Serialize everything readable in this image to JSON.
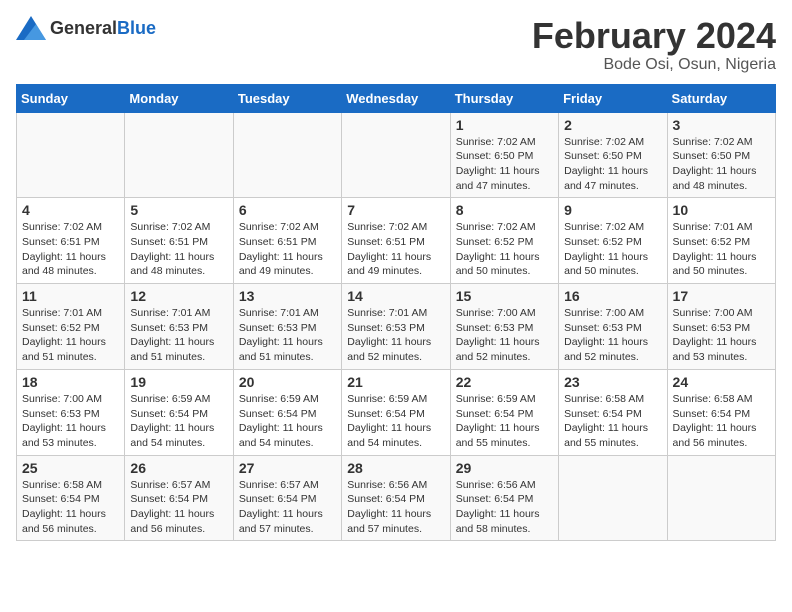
{
  "logo": {
    "text_general": "General",
    "text_blue": "Blue"
  },
  "title": "February 2024",
  "subtitle": "Bode Osi, Osun, Nigeria",
  "columns": [
    "Sunday",
    "Monday",
    "Tuesday",
    "Wednesday",
    "Thursday",
    "Friday",
    "Saturday"
  ],
  "weeks": [
    [
      {
        "day": "",
        "info": ""
      },
      {
        "day": "",
        "info": ""
      },
      {
        "day": "",
        "info": ""
      },
      {
        "day": "",
        "info": ""
      },
      {
        "day": "1",
        "info": "Sunrise: 7:02 AM\nSunset: 6:50 PM\nDaylight: 11 hours and 47 minutes."
      },
      {
        "day": "2",
        "info": "Sunrise: 7:02 AM\nSunset: 6:50 PM\nDaylight: 11 hours and 47 minutes."
      },
      {
        "day": "3",
        "info": "Sunrise: 7:02 AM\nSunset: 6:50 PM\nDaylight: 11 hours and 48 minutes."
      }
    ],
    [
      {
        "day": "4",
        "info": "Sunrise: 7:02 AM\nSunset: 6:51 PM\nDaylight: 11 hours and 48 minutes."
      },
      {
        "day": "5",
        "info": "Sunrise: 7:02 AM\nSunset: 6:51 PM\nDaylight: 11 hours and 48 minutes."
      },
      {
        "day": "6",
        "info": "Sunrise: 7:02 AM\nSunset: 6:51 PM\nDaylight: 11 hours and 49 minutes."
      },
      {
        "day": "7",
        "info": "Sunrise: 7:02 AM\nSunset: 6:51 PM\nDaylight: 11 hours and 49 minutes."
      },
      {
        "day": "8",
        "info": "Sunrise: 7:02 AM\nSunset: 6:52 PM\nDaylight: 11 hours and 50 minutes."
      },
      {
        "day": "9",
        "info": "Sunrise: 7:02 AM\nSunset: 6:52 PM\nDaylight: 11 hours and 50 minutes."
      },
      {
        "day": "10",
        "info": "Sunrise: 7:01 AM\nSunset: 6:52 PM\nDaylight: 11 hours and 50 minutes."
      }
    ],
    [
      {
        "day": "11",
        "info": "Sunrise: 7:01 AM\nSunset: 6:52 PM\nDaylight: 11 hours and 51 minutes."
      },
      {
        "day": "12",
        "info": "Sunrise: 7:01 AM\nSunset: 6:53 PM\nDaylight: 11 hours and 51 minutes."
      },
      {
        "day": "13",
        "info": "Sunrise: 7:01 AM\nSunset: 6:53 PM\nDaylight: 11 hours and 51 minutes."
      },
      {
        "day": "14",
        "info": "Sunrise: 7:01 AM\nSunset: 6:53 PM\nDaylight: 11 hours and 52 minutes."
      },
      {
        "day": "15",
        "info": "Sunrise: 7:00 AM\nSunset: 6:53 PM\nDaylight: 11 hours and 52 minutes."
      },
      {
        "day": "16",
        "info": "Sunrise: 7:00 AM\nSunset: 6:53 PM\nDaylight: 11 hours and 52 minutes."
      },
      {
        "day": "17",
        "info": "Sunrise: 7:00 AM\nSunset: 6:53 PM\nDaylight: 11 hours and 53 minutes."
      }
    ],
    [
      {
        "day": "18",
        "info": "Sunrise: 7:00 AM\nSunset: 6:53 PM\nDaylight: 11 hours and 53 minutes."
      },
      {
        "day": "19",
        "info": "Sunrise: 6:59 AM\nSunset: 6:54 PM\nDaylight: 11 hours and 54 minutes."
      },
      {
        "day": "20",
        "info": "Sunrise: 6:59 AM\nSunset: 6:54 PM\nDaylight: 11 hours and 54 minutes."
      },
      {
        "day": "21",
        "info": "Sunrise: 6:59 AM\nSunset: 6:54 PM\nDaylight: 11 hours and 54 minutes."
      },
      {
        "day": "22",
        "info": "Sunrise: 6:59 AM\nSunset: 6:54 PM\nDaylight: 11 hours and 55 minutes."
      },
      {
        "day": "23",
        "info": "Sunrise: 6:58 AM\nSunset: 6:54 PM\nDaylight: 11 hours and 55 minutes."
      },
      {
        "day": "24",
        "info": "Sunrise: 6:58 AM\nSunset: 6:54 PM\nDaylight: 11 hours and 56 minutes."
      }
    ],
    [
      {
        "day": "25",
        "info": "Sunrise: 6:58 AM\nSunset: 6:54 PM\nDaylight: 11 hours and 56 minutes."
      },
      {
        "day": "26",
        "info": "Sunrise: 6:57 AM\nSunset: 6:54 PM\nDaylight: 11 hours and 56 minutes."
      },
      {
        "day": "27",
        "info": "Sunrise: 6:57 AM\nSunset: 6:54 PM\nDaylight: 11 hours and 57 minutes."
      },
      {
        "day": "28",
        "info": "Sunrise: 6:56 AM\nSunset: 6:54 PM\nDaylight: 11 hours and 57 minutes."
      },
      {
        "day": "29",
        "info": "Sunrise: 6:56 AM\nSunset: 6:54 PM\nDaylight: 11 hours and 58 minutes."
      },
      {
        "day": "",
        "info": ""
      },
      {
        "day": "",
        "info": ""
      }
    ]
  ]
}
